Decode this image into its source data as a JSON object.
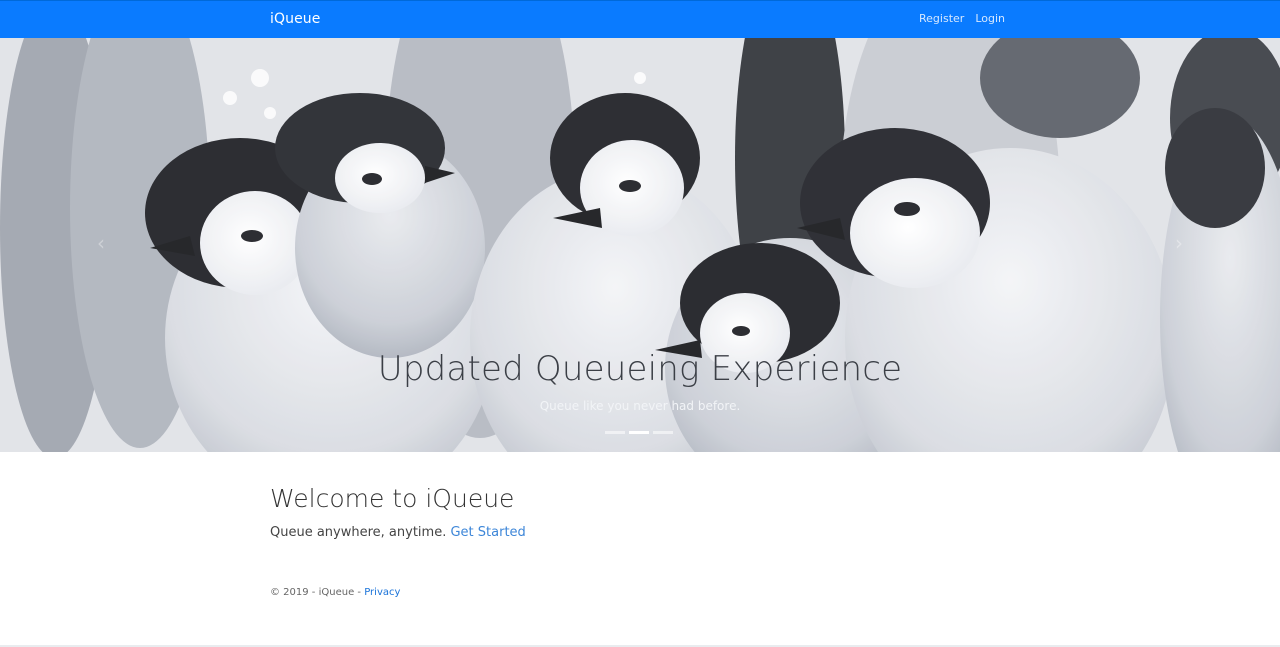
{
  "navbar": {
    "brand": "iQueue",
    "links": [
      "Register",
      "Login"
    ],
    "color": "#0a7bff"
  },
  "carousel": {
    "title": "Updated Queueing Experience",
    "subtitle": "Queue like you never had before.",
    "indicators": 3,
    "active_indicator": 2,
    "prev_icon": "chevron-left-icon",
    "next_icon": "chevron-right-icon"
  },
  "welcome": {
    "title": "Welcome to iQueue",
    "text": "Queue anywhere, anytime.",
    "link": "Get Started"
  },
  "footer": {
    "copyright": "© 2019 - iQueue - ",
    "privacy": "Privacy"
  }
}
